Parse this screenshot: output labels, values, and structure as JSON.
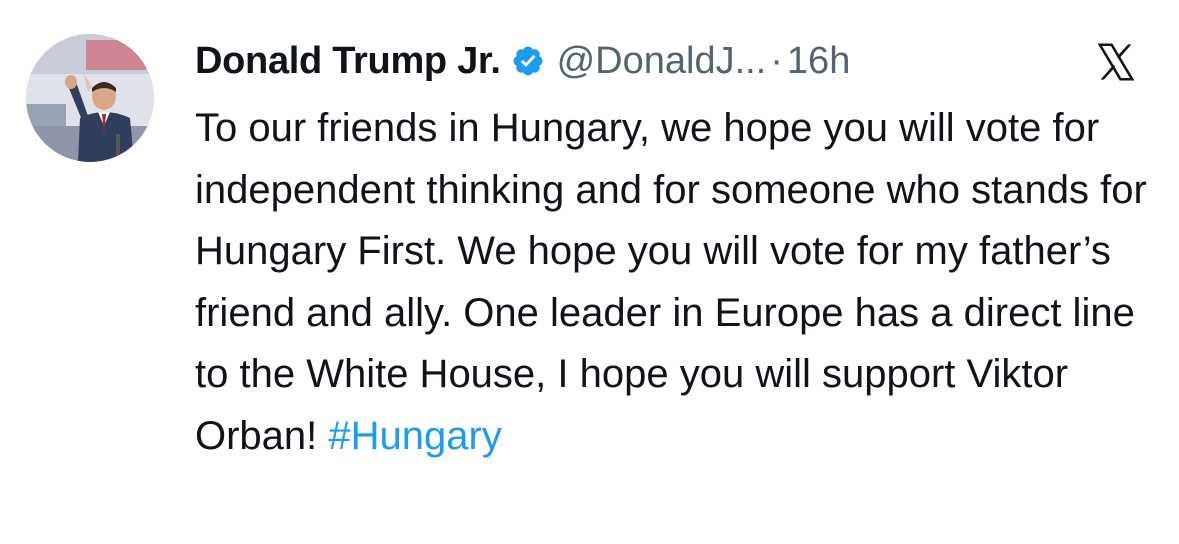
{
  "author": {
    "display_name": "Donald Trump Jr.",
    "handle": "@DonaldJ...",
    "separator": "·",
    "timestamp": "16h",
    "verified": true,
    "avatar_icon": "profile-photo"
  },
  "tweet": {
    "text": "To our friends in Hungary, we hope you will vote for independent thinking and for someone who stands for Hungary First. We hope you will vote for my father’s friend and ally. One leader in Europe has a direct line to the White House, I hope you will support Viktor Orban! ",
    "hashtag": "#Hungary"
  },
  "brand": {
    "logo_icon": "x-logo-icon"
  },
  "colors": {
    "text_primary": "#0f1419",
    "text_secondary": "#536471",
    "link": "#1d9bf0",
    "verified_badge": "#1d9bf0"
  }
}
